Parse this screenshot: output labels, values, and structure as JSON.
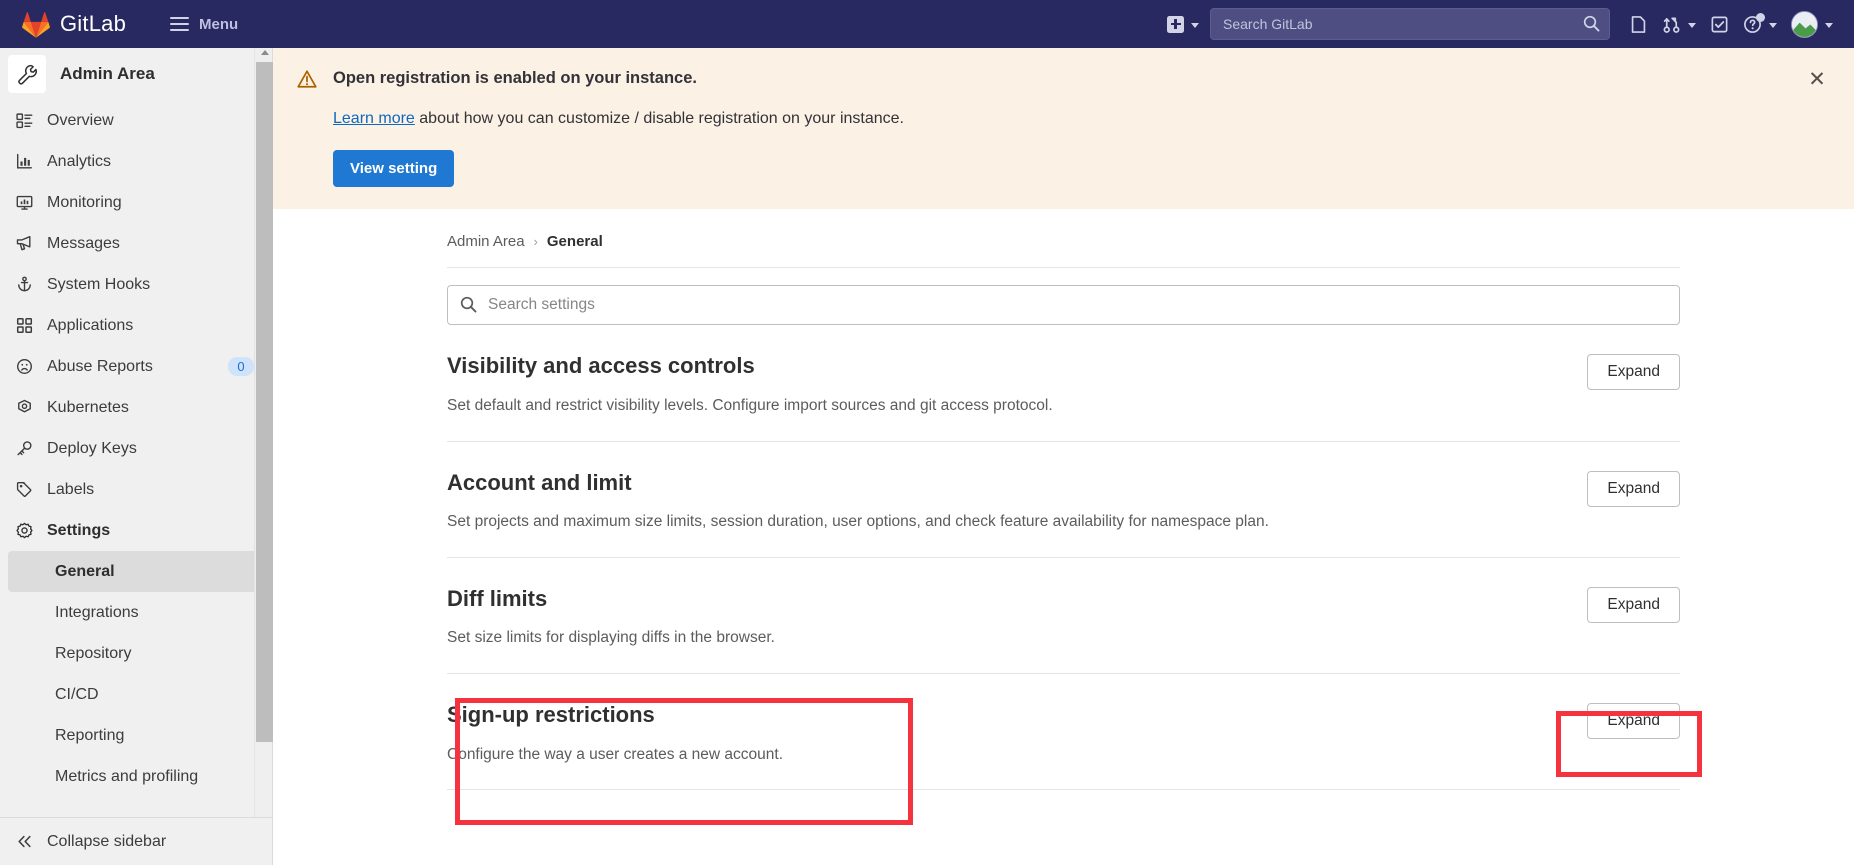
{
  "navbar": {
    "brand": "GitLab",
    "brand_logo_icon": "gitlab-fox-logo",
    "menu_label": "Menu",
    "hamburger_icon": "hamburger-icon",
    "create_new_icon": "plus-square-icon",
    "create_new_caret_icon": "chevron-down-icon",
    "search_placeholder": "Search GitLab",
    "search_value": "",
    "search_icon": "search-icon",
    "issues_icon": "issues-icon",
    "merge_requests_icon": "merge-request-icon",
    "merge_requests_caret_icon": "chevron-down-icon",
    "todos_icon": "todo-checkbox-icon",
    "help_icon": "question-circle-icon",
    "help_caret_icon": "chevron-down-icon",
    "avatar_icon": "user-avatar",
    "avatar_caret_icon": "chevron-down-icon",
    "background_color": "#292961"
  },
  "sidebar": {
    "header": {
      "title": "Admin Area",
      "icon": "wrench-icon"
    },
    "items": [
      {
        "label": "Overview",
        "icon": "overview-list-icon",
        "badge": null
      },
      {
        "label": "Analytics",
        "icon": "chart-bar-icon",
        "badge": null
      },
      {
        "label": "Monitoring",
        "icon": "monitor-icon",
        "badge": null
      },
      {
        "label": "Messages",
        "icon": "megaphone-icon",
        "badge": null
      },
      {
        "label": "System Hooks",
        "icon": "hook-anchor-icon",
        "badge": null
      },
      {
        "label": "Applications",
        "icon": "applications-grid-icon",
        "badge": null
      },
      {
        "label": "Abuse Reports",
        "icon": "sad-face-icon",
        "badge": "0"
      },
      {
        "label": "Kubernetes",
        "icon": "kubernetes-icon",
        "badge": null
      },
      {
        "label": "Deploy Keys",
        "icon": "key-icon",
        "badge": null
      },
      {
        "label": "Labels",
        "icon": "label-tag-icon",
        "badge": null
      },
      {
        "label": "Settings",
        "icon": "gear-icon",
        "badge": null,
        "bold": true
      }
    ],
    "subitems": [
      {
        "label": "General",
        "active": true
      },
      {
        "label": "Integrations",
        "active": false
      },
      {
        "label": "Repository",
        "active": false
      },
      {
        "label": "CI/CD",
        "active": false
      },
      {
        "label": "Reporting",
        "active": false
      },
      {
        "label": "Metrics and profiling",
        "active": false
      }
    ],
    "footer": {
      "label": "Collapse sidebar",
      "icon": "chevron-double-left-icon"
    },
    "badge_color": "#cfe3fc"
  },
  "alert": {
    "icon": "warning-triangle-icon",
    "title": "Open registration is enabled on your instance.",
    "link_text": "Learn more",
    "description_rest": " about how you can customize / disable registration on your instance.",
    "button_label": "View setting",
    "close_icon": "close-icon",
    "background_color": "#fcf1e5",
    "button_color": "#1f78d1"
  },
  "breadcrumb": {
    "root": "Admin Area",
    "separator": "›",
    "current": "General"
  },
  "settings_search": {
    "placeholder": "Search settings",
    "value": "",
    "icon": "search-icon"
  },
  "sections": [
    {
      "title": "Visibility and access controls",
      "description": "Set default and restrict visibility levels. Configure import sources and git access protocol.",
      "button_label": "Expand"
    },
    {
      "title": "Account and limit",
      "description": "Set projects and maximum size limits, session duration, user options, and check feature availability for namespace plan.",
      "button_label": "Expand"
    },
    {
      "title": "Diff limits",
      "description": "Set size limits for displaying diffs in the browser.",
      "button_label": "Expand"
    },
    {
      "title": "Sign-up restrictions",
      "description": "Configure the way a user creates a new account.",
      "button_label": "Expand"
    }
  ],
  "annotations": {
    "color": "#f5333f",
    "boxes": [
      {
        "target": "Sign-up restrictions"
      },
      {
        "target": "Expand"
      }
    ]
  }
}
